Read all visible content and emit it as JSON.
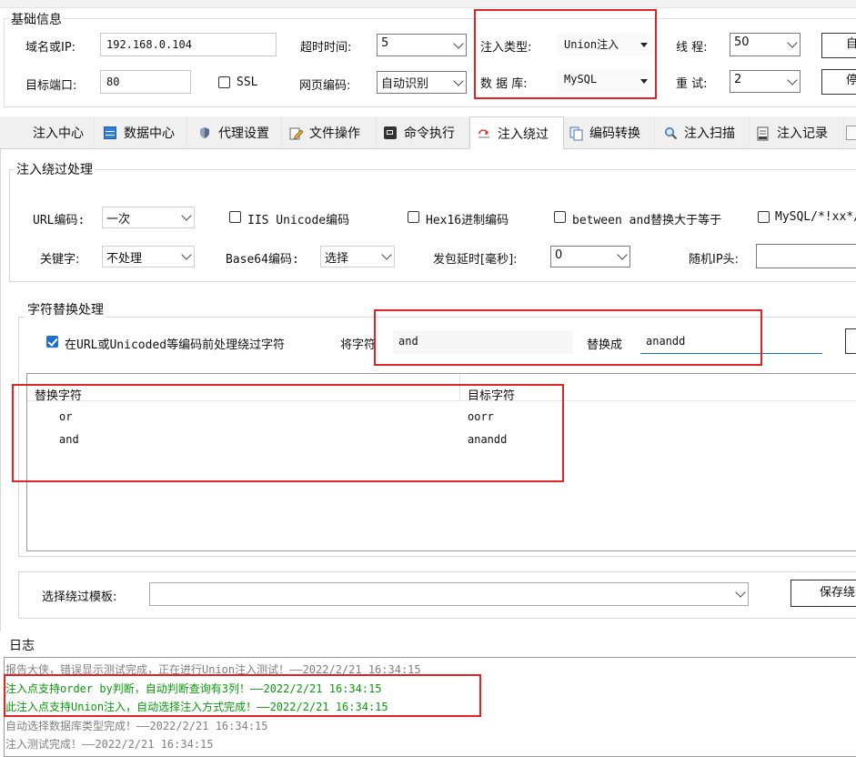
{
  "basic": {
    "title": "基础信息",
    "domain_label": "域名或IP:",
    "domain_value": "192.168.0.104",
    "timeout_label": "超时时间:",
    "timeout_value": "5",
    "inject_type_label": "注入类型:",
    "inject_type_value": "Union注入",
    "threads_label": "线 程:",
    "threads_value": "50",
    "btn_top": "自",
    "port_label": "目标端口:",
    "port_value": "80",
    "ssl_label": "SSL",
    "encoding_label": "网页编码:",
    "encoding_value": "自动识别",
    "db_label": "数 据 库:",
    "db_value": "MySQL",
    "retry_label": "重 试:",
    "retry_value": "2",
    "btn_bottom": "停"
  },
  "tabs": [
    {
      "label": "注入中心",
      "icon": "none"
    },
    {
      "label": "数据中心",
      "icon": "table-icon"
    },
    {
      "label": "代理设置",
      "icon": "shield-icon"
    },
    {
      "label": "文件操作",
      "icon": "edit-file-icon"
    },
    {
      "label": "命令执行",
      "icon": "terminal-icon"
    },
    {
      "label": "注入绕过",
      "icon": "bypass-icon"
    },
    {
      "label": "编码转换",
      "icon": "copy-icon"
    },
    {
      "label": "注入扫描",
      "icon": "magnifier-icon"
    },
    {
      "label": "注入记录",
      "icon": "record-icon"
    }
  ],
  "bypass": {
    "title": "注入绕过处理",
    "url_enc_label": "URL编码:",
    "url_enc_value": "一次",
    "iis_unicode_label": "IIS Unicode编码",
    "hex16_label": "Hex16进制编码",
    "between_label": "between and替换大于等于",
    "mysql_comment_label": "MySQL/*!xx*/",
    "keyword_label": "关键字:",
    "keyword_value": "不处理",
    "base64_label": "Base64编码:",
    "base64_value": "选择",
    "delay_label": "发包延时[毫秒]:",
    "delay_value": "0",
    "random_ip_label": "随机IP头:",
    "random_ip_value": ""
  },
  "replace": {
    "title": "字符替换处理",
    "preprocess_label": "在URL或Unicoded等编码前处理绕过字符",
    "from_label": "将字符",
    "from_value": "and",
    "to_label": "替换成",
    "to_value": "anandd",
    "col_source": "替换字符",
    "col_target": "目标字符",
    "rows": [
      {
        "source": "or",
        "target": "oorr"
      },
      {
        "source": "and",
        "target": "anandd"
      }
    ]
  },
  "template": {
    "label": "选择绕过模板:",
    "value": "",
    "save_label": "保存绕"
  },
  "log": {
    "title": "日志",
    "lines": [
      {
        "text": "报告大侠，错误显示测试完成，正在进行Union注入测试！——2022/2/21 16:34:15",
        "color": "#808080"
      },
      {
        "text": "注入点支持order by判断，自动判断查询有3列！——2022/2/21 16:34:15",
        "color": "#0a9a0a"
      },
      {
        "text": "此注入点支持Union注入，自动选择注入方式完成！——2022/2/21 16:34:15",
        "color": "#0a9a0a"
      },
      {
        "text": "自动选择数据库类型完成！——2022/2/21 16:34:15",
        "color": "#808080"
      },
      {
        "text": "注入测试完成！——2022/2/21 16:34:15",
        "color": "#808080"
      }
    ]
  }
}
